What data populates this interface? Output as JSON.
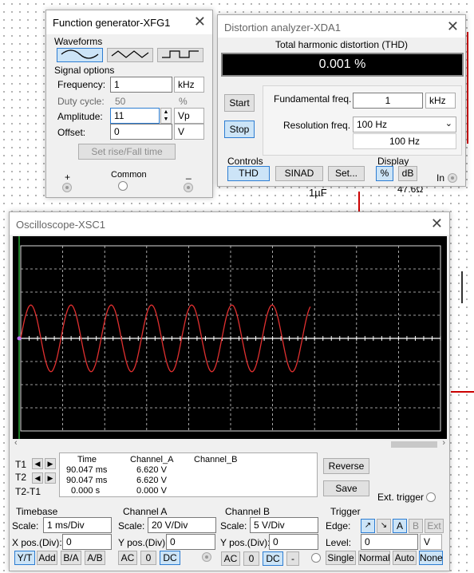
{
  "funcgen": {
    "title": "Function generator-XFG1",
    "waveforms_label": "Waveforms",
    "signal_options_label": "Signal options",
    "frequency_label": "Frequency:",
    "frequency_value": "1",
    "frequency_unit": "kHz",
    "duty_label": "Duty cycle:",
    "duty_value": "50",
    "duty_unit": "%",
    "amplitude_label": "Amplitude:",
    "amplitude_value": "11",
    "amplitude_unit": "Vp",
    "offset_label": "Offset:",
    "offset_value": "0",
    "offset_unit": "V",
    "set_rise_fall_label": "Set rise/Fall time",
    "plus_label": "+",
    "common_label": "Common",
    "minus_label": "_"
  },
  "distortion": {
    "title": "Distortion analyzer-XDA1",
    "thd_header": "Total harmonic distortion (THD)",
    "thd_value": "0.001 %",
    "start_label": "Start",
    "stop_label": "Stop",
    "fundamental_label": "Fundamental freq.",
    "fundamental_value": "1",
    "fundamental_unit": "kHz",
    "resolution_label": "Resolution freq.",
    "resolution_value": "100 Hz",
    "resolution_display": "100 Hz",
    "controls_label": "Controls",
    "thd_btn": "THD",
    "sinad_btn": "SINAD",
    "set_btn": "Set...",
    "display_label": "Display",
    "percent_btn": "%",
    "db_btn": "dB",
    "in_label": "In"
  },
  "schematic": {
    "cap_label": "1µF",
    "res_label": "47.6Ω"
  },
  "oscilloscope": {
    "title": "Oscilloscope-XSC1",
    "cursor_headers": [
      "Time",
      "Channel_A",
      "Channel_B"
    ],
    "t1_label": "T1",
    "t2_label": "T2",
    "t2t1_label": "T2-T1",
    "t1_time": "90.047 ms",
    "t1_cha": "6.620 V",
    "t2_time": "90.047 ms",
    "t2_cha": "6.620 V",
    "dt_time": "0.000 s",
    "dt_cha": "0.000 V",
    "reverse_label": "Reverse",
    "save_label": "Save",
    "ext_trigger_label": "Ext. trigger",
    "timebase": {
      "label": "Timebase",
      "scale_label": "Scale:",
      "scale_value": "1 ms/Div",
      "xpos_label": "X pos.(Div):",
      "xpos_value": "0",
      "yt": "Y/T",
      "add": "Add",
      "ba": "B/A",
      "ab": "A/B"
    },
    "channel_a": {
      "label": "Channel A",
      "scale_label": "Scale:",
      "scale_value": "20  V/Div",
      "ypos_label": "Y pos.(Div):",
      "ypos_value": "0",
      "ac": "AC",
      "zero": "0",
      "dc": "DC"
    },
    "channel_b": {
      "label": "Channel B",
      "scale_label": "Scale:",
      "scale_value": "5  V/Div",
      "ypos_label": "Y pos.(Div):",
      "ypos_value": "0",
      "ac": "AC",
      "zero": "0",
      "dc": "DC",
      "minus": "-"
    },
    "trigger": {
      "label": "Trigger",
      "edge_label": "Edge:",
      "a": "A",
      "b": "B",
      "ext": "Ext",
      "level_label": "Level:",
      "level_value": "0",
      "level_unit": "V",
      "single": "Single",
      "normal": "Normal",
      "auto": "Auto",
      "none": "None"
    },
    "trace": {
      "color": "#e03030",
      "cycles_shown": 7.2
    }
  }
}
